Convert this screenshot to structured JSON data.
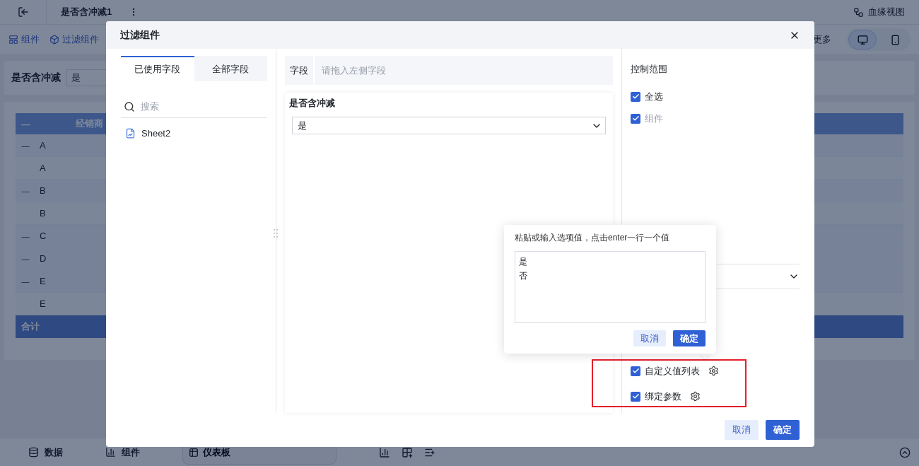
{
  "app": {
    "title": "是否含冲减1",
    "lineage": "血缘视图"
  },
  "toolbar": {
    "items": [
      {
        "kind": "component",
        "label": "组件"
      },
      {
        "kind": "filter",
        "label": "过滤组件"
      }
    ],
    "more": "更多",
    "views": [
      {
        "kind": "desktop",
        "selected": true
      },
      {
        "kind": "mobile",
        "selected": false
      }
    ]
  },
  "filter_bar": {
    "label": "是否含冲减",
    "value": "是"
  },
  "table": {
    "collapse": "—",
    "header": "经销商",
    "rows": [
      {
        "kind": "group",
        "label": "A"
      },
      {
        "kind": "leaf",
        "label": "A"
      },
      {
        "kind": "group",
        "label": "B"
      },
      {
        "kind": "leaf",
        "label": "B"
      },
      {
        "kind": "group",
        "label": "C"
      },
      {
        "kind": "group",
        "label": "D"
      },
      {
        "kind": "group",
        "label": "E"
      },
      {
        "kind": "leaf",
        "label": "E"
      }
    ],
    "total": "合计"
  },
  "bottom_bar": {
    "tabs": [
      {
        "kind": "data",
        "label": "数据"
      },
      {
        "kind": "chart",
        "label": "组件"
      }
    ],
    "dashboard": "仪表板"
  },
  "dialog": {
    "title": "过滤组件",
    "field_tabs": [
      {
        "label": "已使用字段",
        "selected": true
      },
      {
        "label": "全部字段",
        "selected": false
      }
    ],
    "search": {
      "placeholder": "搜索"
    },
    "sources": [
      "Sheet2"
    ],
    "field": {
      "label": "字段",
      "placeholder": "请拖入左侧字段"
    },
    "preview": {
      "title": "是否含冲减",
      "value": "是"
    },
    "scope": {
      "title": "控制范围",
      "options": [
        {
          "label": "全选",
          "checked": true,
          "disabled": false
        },
        {
          "label": "组件",
          "checked": true,
          "disabled": true
        }
      ]
    },
    "advanced": [
      {
        "label": "自定义值列表",
        "checked": true
      },
      {
        "label": "绑定参数",
        "checked": true
      }
    ],
    "popover": {
      "hint": "粘贴或输入选项值，点击enter一行一个值",
      "lines": [
        "是",
        "否"
      ],
      "cancel": "取消",
      "confirm": "确定"
    },
    "cancel": "取消",
    "confirm": "确定"
  }
}
